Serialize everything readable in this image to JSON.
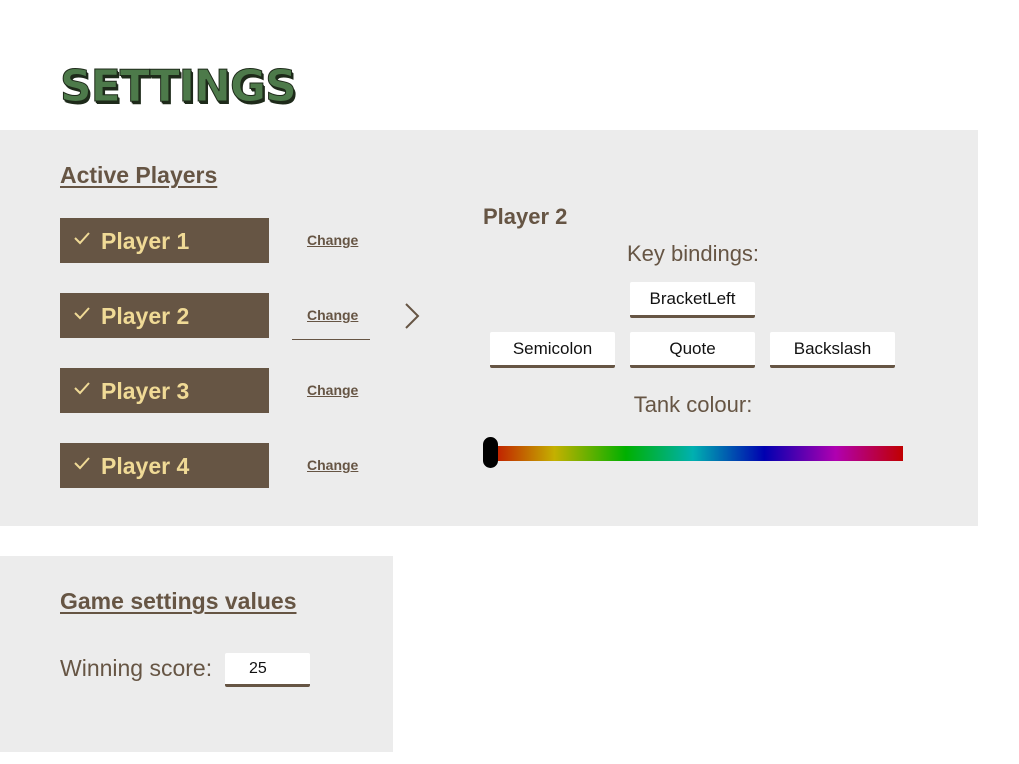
{
  "page": {
    "title": "SETTINGS"
  },
  "active_players": {
    "heading": "Active Players",
    "change_label": "Change",
    "players": [
      {
        "label": "Player 1",
        "checked": true
      },
      {
        "label": "Player 2",
        "checked": true,
        "selected": true
      },
      {
        "label": "Player 3",
        "checked": true
      },
      {
        "label": "Player 4",
        "checked": true
      }
    ]
  },
  "player_detail": {
    "title": "Player 2",
    "key_bindings_label": "Key bindings:",
    "keys": {
      "up": "BracketLeft",
      "left": "Semicolon",
      "down": "Quote",
      "right": "Backslash"
    },
    "tank_colour_label": "Tank colour:",
    "tank_colour_hue_fraction": 0.0
  },
  "game_settings": {
    "heading": "Game settings values",
    "winning_score_label": "Winning score:",
    "winning_score_value": "25"
  },
  "colors": {
    "title_green": "#4d7a4a",
    "brown": "#665544",
    "player_text": "#f0da96",
    "panel_bg": "#ececec"
  }
}
